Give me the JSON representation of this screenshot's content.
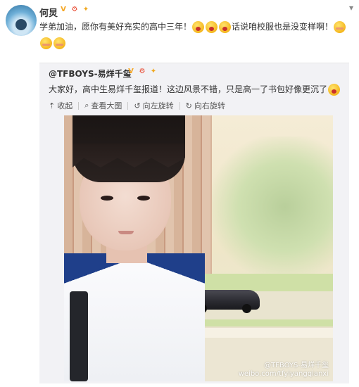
{
  "post": {
    "username": "何炅",
    "badges": [
      "V",
      "⚙",
      "✦"
    ],
    "text_main": "学弟加油，愿你有美好充实的高中三年！",
    "text_after": "话说咱校服也是没变样啊！",
    "menu_icon": "chevron-down-icon"
  },
  "repost": {
    "author": "@TFBOYS-易烊千玺",
    "badges": [
      "V",
      "⚙",
      "✦"
    ],
    "text": "大家好，高中生易烊千玺报道！这边风景不错，只是高一了书包好像更沉了",
    "actions": {
      "collapse": "收起",
      "view_large": "查看大图",
      "rotate_left": "向左旋转",
      "rotate_right": "向右旋转"
    },
    "watermark_line1": "@TFBOYS-易烊千玺",
    "watermark_line2": "weibo.com/tfyiyangqianxi"
  }
}
